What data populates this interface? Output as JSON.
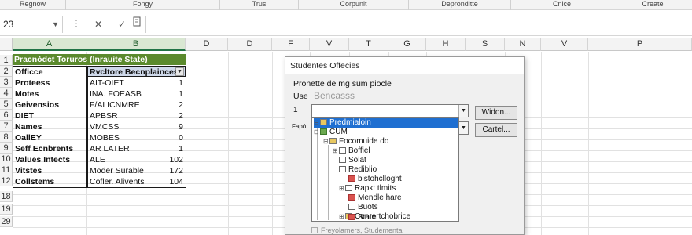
{
  "ribbon": {
    "groups": [
      "Regnow",
      "Fongy",
      "Trus",
      "Corpunit",
      "Depronditte",
      "Cnice",
      "Create"
    ]
  },
  "formula_bar": {
    "name_box": "23",
    "cancel_icon": "✕",
    "enter_icon": "✓",
    "fx_icon": "fx"
  },
  "columns": [
    "A",
    "B",
    "D",
    "D",
    "F",
    "V",
    "T",
    "G",
    "H",
    "S",
    "N",
    "V",
    "P"
  ],
  "rows": [
    "1",
    "2",
    "3",
    "4",
    "5",
    "6",
    "7",
    "8",
    "9",
    "10",
    "11",
    "12",
    "18",
    "19",
    "29"
  ],
  "sheet": {
    "title": "Pracnódct Toruros (Inrauite State)",
    "header_a": "Officce",
    "header_b": "Rvcltore Becnplainces",
    "rows": [
      {
        "a": "Proteess",
        "b": "AIT-OIET",
        "c": "1"
      },
      {
        "a": "Motes",
        "b": "INA. FOEASB",
        "c": "1"
      },
      {
        "a": "Geivensios",
        "b": "F/ALICNMRE",
        "c": "2"
      },
      {
        "a": "DIET",
        "b": "APBSR",
        "c": "2"
      },
      {
        "a": "Names",
        "b": "VMCSS",
        "c": "9"
      },
      {
        "a": "OallEY",
        "b": "MOBES",
        "c": "0"
      },
      {
        "a": "Seff Ecnbrents",
        "b": "AR LATER",
        "c": "1"
      },
      {
        "a": "Values Intects",
        "b": "ALE",
        "c": "102"
      },
      {
        "a": "Vitstes",
        "b": "Moder Surable",
        "c": "172"
      },
      {
        "a": "Collstems",
        "b": "Cofler. Alivents",
        "c": "104"
      }
    ]
  },
  "dialog": {
    "title": "Studentes Offecies",
    "prompt": "Pronette de mg sum piocle",
    "use_label": "Use",
    "use_value": "Bencasss",
    "label_1": "1",
    "label_2": "Fapó:",
    "buttons": {
      "ok": "Widon...",
      "cancel": "Cartel..."
    },
    "tree": [
      {
        "label": "Predmialoin",
        "icon": "folder-icon",
        "selected": true
      },
      {
        "label": "CUM",
        "icon": "folder-green-icon"
      },
      {
        "label": "Focomuide do",
        "icon": "folder-icon"
      },
      {
        "label": "Boffiel",
        "icon": "doc-icon"
      },
      {
        "label": "Solat",
        "icon": "doc-icon"
      },
      {
        "label": "Rediblio",
        "icon": "doc-icon"
      },
      {
        "label": "bistohclloght",
        "icon": "link-icon"
      },
      {
        "label": "Rapkt tlmits",
        "icon": "gear-icon"
      },
      {
        "label": "Mendle hare",
        "icon": "pin-icon"
      },
      {
        "label": "Buots",
        "icon": "doc-icon"
      },
      {
        "label": "Cenrertchobrice",
        "icon": "folder-icon"
      },
      {
        "label": "State",
        "icon": "pin-icon"
      }
    ],
    "footer": "Freyolamers, Studementa"
  },
  "colors": {
    "title_band": "#5b8a2d",
    "header_b_fill": "#cfd9ea",
    "selection": "#1f6fd1"
  }
}
